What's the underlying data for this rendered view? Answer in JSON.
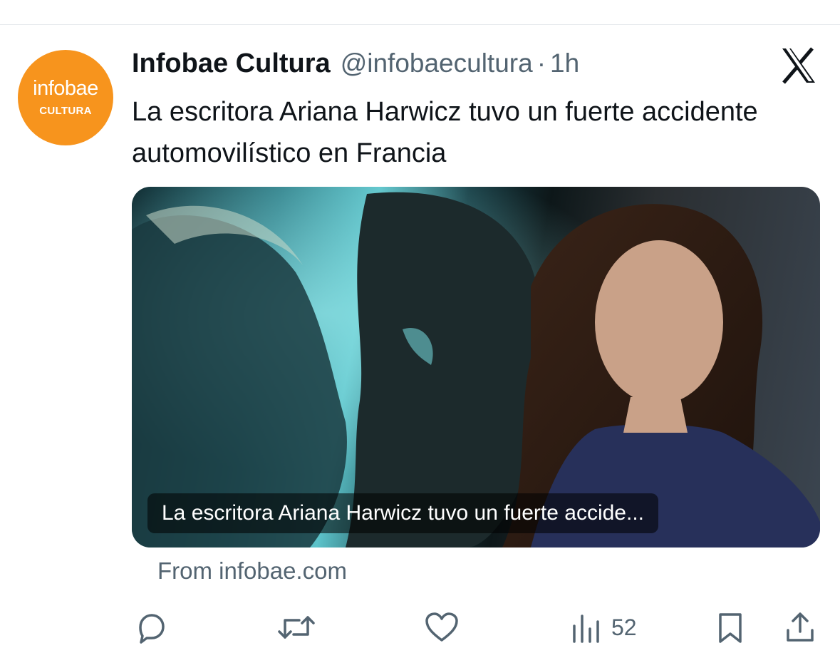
{
  "account": {
    "avatar_text_main": "infobae",
    "avatar_text_sub": "CULTURA",
    "display_name": "Infobae Cultura",
    "handle": "@infobaecultura",
    "separator": "·",
    "time": "1h"
  },
  "tweet": {
    "text": "La escritora Ariana Harwicz tuvo un fuerte accidente automovilístico en Francia"
  },
  "media": {
    "caption": "La escritora Ariana Harwicz tuvo un fuerte accide..."
  },
  "source": {
    "label": "From infobae.com"
  },
  "actions": {
    "views_count": "52"
  },
  "icons": {
    "platform_logo": "x-logo-icon",
    "reply": "reply-icon",
    "retweet": "retweet-icon",
    "like": "heart-icon",
    "views": "views-icon",
    "bookmark": "bookmark-icon",
    "share": "share-icon"
  },
  "colors": {
    "avatar_bg": "#f7941d",
    "text_primary": "#0f1419",
    "text_secondary": "#536471"
  }
}
